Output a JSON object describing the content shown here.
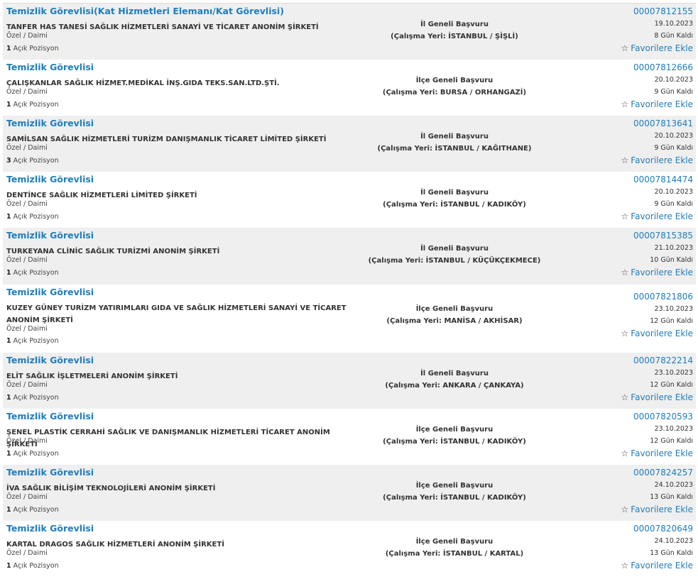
{
  "positions_suffix": "Açık Pozisyon",
  "favorite_label": "Favorilere Ekle",
  "colors": {
    "link": "#1f7dbd",
    "row_alt": "#efefef",
    "text": "#333333"
  },
  "icons": {
    "favorite": "star-outline-icon"
  },
  "listings": [
    {
      "title": "Temizlik Görevlisi(Kat Hizmetleri Elemanı/Kat Görevlisi)",
      "company": "TANFER HAS TANESİ SAĞLIK HİZMETLERİ SANAYİ VE TİCARET ANONİM ŞİRKETİ",
      "type": "Özel / Daimi",
      "positions": "1",
      "scope": "İl Geneli Başvuru",
      "location": "(Çalışma Yeri: İSTANBUL / ŞİŞLİ)",
      "job_no": "00007812155",
      "date": "19.10.2023",
      "days_left": "8 Gün Kaldı"
    },
    {
      "title": "Temizlik Görevlisi",
      "company": "ÇALIŞKANLAR SAĞLIK HİZMET.MEDİKAL İNŞ.GIDA TEKS.SAN.LTD.ŞTİ.",
      "type": "Özel / Daimi",
      "positions": "1",
      "scope": "İlçe Geneli Başvuru",
      "location": "(Çalışma Yeri: BURSA / ORHANGAZİ)",
      "job_no": "00007812666",
      "date": "20.10.2023",
      "days_left": "9 Gün Kaldı"
    },
    {
      "title": "Temizlik Görevlisi",
      "company": "SAMİLSAN SAĞLIK HİZMETLERİ TURİZM DANIŞMANLIK TİCARET LİMİTED ŞİRKETİ",
      "type": "Özel / Daimi",
      "positions": "3",
      "scope": "İl Geneli Başvuru",
      "location": "(Çalışma Yeri: İSTANBUL / KAĞITHANE)",
      "job_no": "00007813641",
      "date": "20.10.2023",
      "days_left": "9 Gün Kaldı"
    },
    {
      "title": "Temizlik Görevlisi",
      "company": "DENTİNCE SAĞLIK HİZMETLERİ LİMİTED ŞİRKETİ",
      "type": "Özel / Daimi",
      "positions": "1",
      "scope": "İl Geneli Başvuru",
      "location": "(Çalışma Yeri: İSTANBUL / KADIKÖY)",
      "job_no": "00007814474",
      "date": "20.10.2023",
      "days_left": "9 Gün Kaldı"
    },
    {
      "title": "Temizlik Görevlisi",
      "company": "TURKEYANA CLİNİC SAĞLIK TURİZMİ ANONİM ŞİRKETİ",
      "type": "Özel / Daimi",
      "positions": "1",
      "scope": "İl Geneli Başvuru",
      "location": "(Çalışma Yeri: İSTANBUL / KÜÇÜKÇEKMECE)",
      "job_no": "00007815385",
      "date": "21.10.2023",
      "days_left": "10 Gün Kaldı"
    },
    {
      "title": "Temizlik Görevlisi",
      "company": "KUZEY GÜNEY TURİZM YATIRIMLARI GIDA VE SAĞLIK HİZMETLERİ SANAYİ VE TİCARET ANONİM ŞİRKETİ",
      "type": "Özel / Daimi",
      "positions": "1",
      "scope": "İlçe Geneli Başvuru",
      "location": "(Çalışma Yeri: MANİSA / AKHİSAR)",
      "job_no": "00007821806",
      "date": "23.10.2023",
      "days_left": "12 Gün Kaldı"
    },
    {
      "title": "Temizlik Görevlisi",
      "company": "ELİT SAĞLIK İŞLETMELERİ ANONİM ŞİRKETİ",
      "type": "Özel / Daimi",
      "positions": "1",
      "scope": "İl Geneli Başvuru",
      "location": "(Çalışma Yeri: ANKARA / ÇANKAYA)",
      "job_no": "00007822214",
      "date": "23.10.2023",
      "days_left": "12 Gün Kaldı"
    },
    {
      "title": "Temizlik Görevlisi",
      "company": "ŞENEL PLASTİK CERRAHİ SAĞLIK VE DANIŞMANLIK HİZMETLERİ TİCARET ANONİM ŞİRKETİ",
      "type": "Özel / Daimi",
      "positions": "1",
      "scope": "İlçe Geneli Başvuru",
      "location": "(Çalışma Yeri: İSTANBUL / KADIKÖY)",
      "job_no": "00007820593",
      "date": "23.10.2023",
      "days_left": "12 Gün Kaldı"
    },
    {
      "title": "Temizlik Görevlisi",
      "company": "İVA SAĞLIK BİLİŞİM TEKNOLOJİLERİ ANONİM ŞİRKETİ",
      "type": "Özel / Daimi",
      "positions": "1",
      "scope": "İlçe Geneli Başvuru",
      "location": "(Çalışma Yeri: İSTANBUL / KADIKÖY)",
      "job_no": "00007824257",
      "date": "24.10.2023",
      "days_left": "13 Gün Kaldı"
    },
    {
      "title": "Temizlik Görevlisi",
      "company": "KARTAL DRAGOS SAĞLIK HİZMETLERİ ANONİM ŞİRKETİ",
      "type": "Özel / Daimi",
      "positions": "1",
      "scope": "İlçe Geneli Başvuru",
      "location": "(Çalışma Yeri: İSTANBUL / KARTAL)",
      "job_no": "00007820649",
      "date": "24.10.2023",
      "days_left": "13 Gün Kaldı"
    }
  ]
}
